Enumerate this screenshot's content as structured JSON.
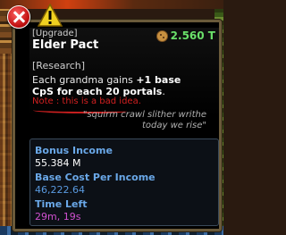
{
  "tooltip": {
    "tag": "[Upgrade]",
    "title": "Elder Pact",
    "price": "2.560 T",
    "price_icon": "cookie-icon",
    "category": "[Research]",
    "desc_line1_pre": "Each grandma gains ",
    "desc_line1_bold": "+1 base",
    "desc_line2_bold": "CpS for each 20 portals",
    "desc_line2_post": ".",
    "note": "Note : this is a bad idea.",
    "quote_line1": "\"squirm crawl slither writhe",
    "quote_line2": "today we rise\""
  },
  "stats": {
    "bonus_income_label": "Bonus Income",
    "bonus_income_value": "55.384 M",
    "base_cost_label": "Base Cost Per Income",
    "base_cost_value": "46,222.64",
    "time_left_label": "Time Left",
    "time_left_value": "29m, 19s"
  },
  "icons": {
    "close": "close-icon",
    "warning": "warning-icon"
  },
  "colors": {
    "price": "#6ae06a",
    "note": "#d02020",
    "stat_label": "#6aa8e8",
    "time_left": "#d050d0"
  }
}
